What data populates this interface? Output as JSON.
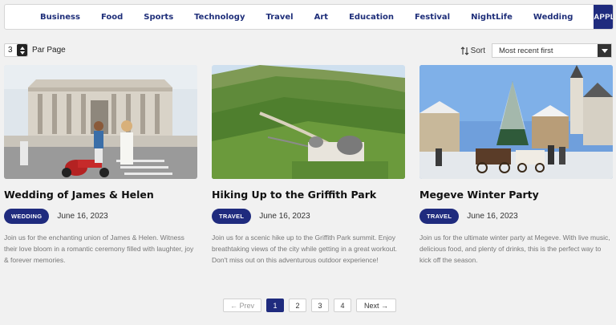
{
  "categories": [
    "Business",
    "Food",
    "Sports",
    "Technology",
    "Travel",
    "Art",
    "Education",
    "Festival",
    "NightLife",
    "Wedding"
  ],
  "apply_label": "APPLY",
  "per_page": {
    "value": "3",
    "label": "Par Page"
  },
  "sort": {
    "label": "Sort",
    "selected": "Most recent first"
  },
  "cards": [
    {
      "title": "Wedding of James & Helen",
      "badge": "WEDDING",
      "date": "June 16, 2023",
      "description": "Join us for the enchanting union of James & Helen. Witness their love bloom in a romantic ceremony filled with laughter, joy & forever memories."
    },
    {
      "title": "Hiking Up to the Griffith Park",
      "badge": "TRAVEL",
      "date": "June 16, 2023",
      "description": "Join us for a scenic hike up to the Griffith Park summit. Enjoy breathtaking views of the city while getting in a great workout. Don't miss out on this adventurous outdoor experience!"
    },
    {
      "title": "Megeve Winter Party",
      "badge": "TRAVEL",
      "date": "June 16, 2023",
      "description": "Join us for the ultimate winter party at Megeve. With live music, delicious food, and plenty of drinks, this is the perfect way to kick off the season."
    }
  ],
  "pagination": {
    "prev": "Prev",
    "pages": [
      "1",
      "2",
      "3",
      "4"
    ],
    "current": "1",
    "next": "Next"
  },
  "colors": {
    "primary": "#1f2b7e",
    "background": "#f1f1f1",
    "muted_text": "#777777"
  }
}
